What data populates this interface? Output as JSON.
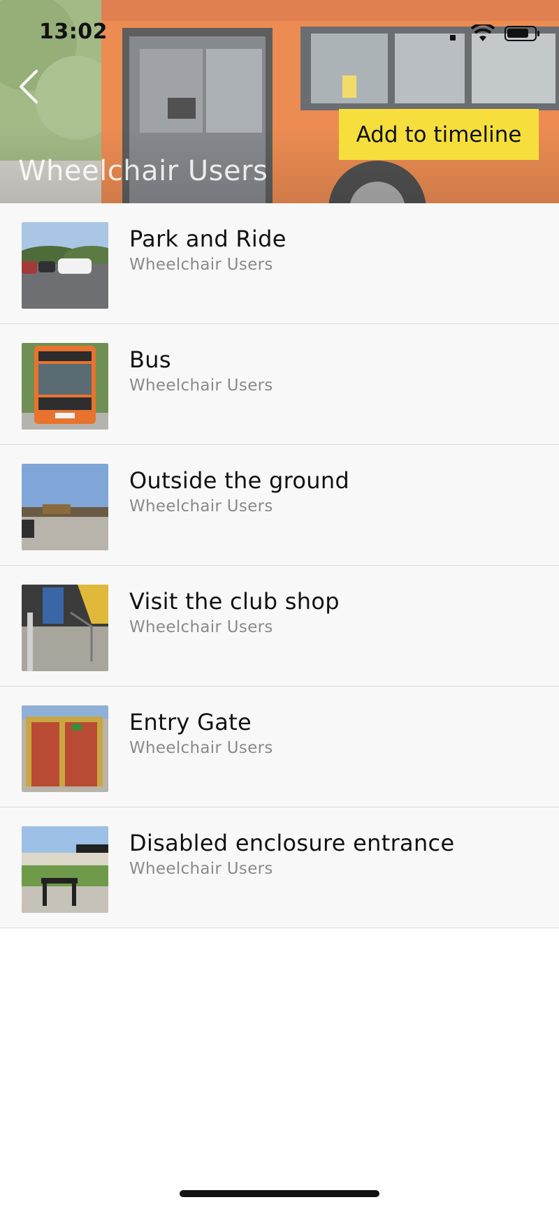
{
  "status_bar": {
    "time": "13:02",
    "icons": [
      "signal-icon",
      "wifi-icon",
      "battery-icon"
    ]
  },
  "header": {
    "back_icon": "chevron-left-icon",
    "add_button_label": "Add to timeline",
    "title": "Wheelchair Users",
    "colors": {
      "button_bg": "#f6df3c",
      "bus_orange": "#e8732e"
    }
  },
  "list": {
    "items": [
      {
        "title": "Park and Ride",
        "subtitle": "Wheelchair Users",
        "thumbnail": "car-park-photo"
      },
      {
        "title": "Bus",
        "subtitle": "Wheelchair Users",
        "thumbnail": "bus-photo"
      },
      {
        "title": "Outside the ground",
        "subtitle": "Wheelchair Users",
        "thumbnail": "ground-exterior-photo"
      },
      {
        "title": "Visit the club shop",
        "subtitle": "Wheelchair Users",
        "thumbnail": "club-shop-photo"
      },
      {
        "title": "Entry Gate",
        "subtitle": "Wheelchair Users",
        "thumbnail": "entry-gate-photo"
      },
      {
        "title": "Disabled enclosure entrance",
        "subtitle": "Wheelchair Users",
        "thumbnail": "enclosure-photo"
      }
    ]
  }
}
